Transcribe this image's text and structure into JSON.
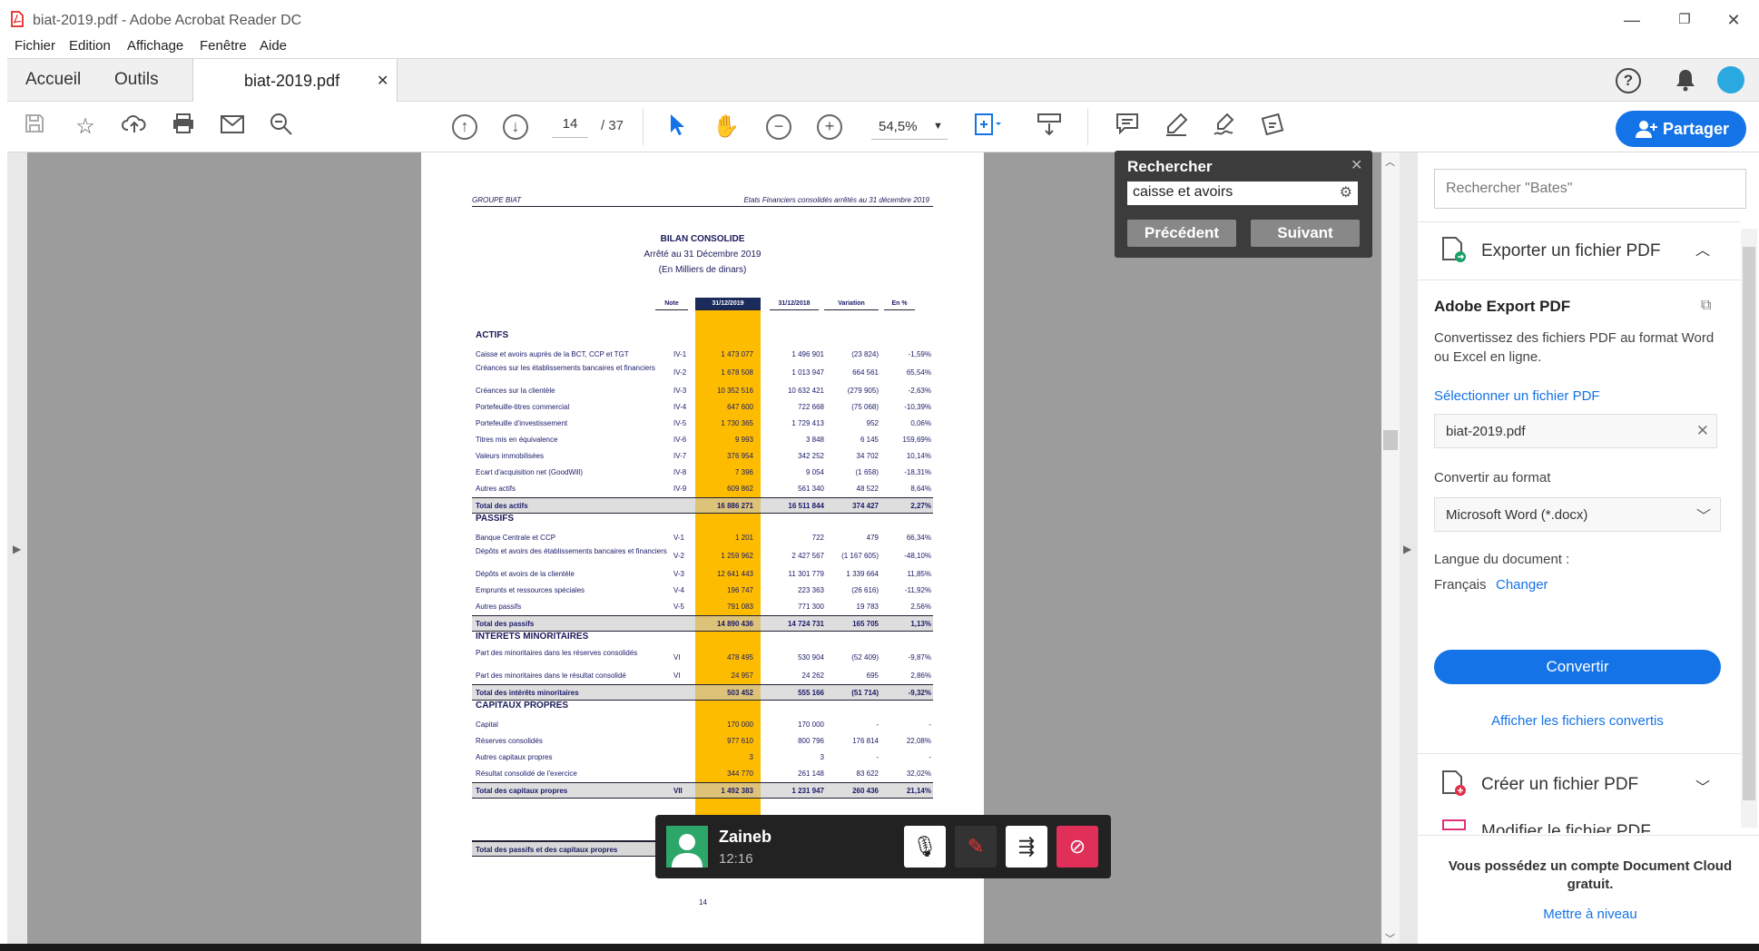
{
  "window": {
    "title": "biat-2019.pdf - Adobe Acrobat Reader DC"
  },
  "menu": [
    "Fichier",
    "Edition",
    "Affichage",
    "Fenêtre",
    "Aide"
  ],
  "tabs": {
    "home": "Accueil",
    "tools": "Outils",
    "doc": "biat-2019.pdf"
  },
  "toolbar": {
    "page_current": "14",
    "page_total": "/ 37",
    "zoom": "54,5%",
    "share": "Partager"
  },
  "find": {
    "title": "Rechercher",
    "value": "caisse et avoirs",
    "prev": "Précédent",
    "next": "Suivant"
  },
  "right": {
    "search_placeholder": "Rechercher \"Bates\"",
    "export_title": "Exporter un fichier PDF",
    "adobe_export": "Adobe Export PDF",
    "desc": "Convertissez des fichiers PDF au format Word ou Excel en ligne.",
    "select_file": "Sélectionner un fichier PDF",
    "file": "biat-2019.pdf",
    "convert_to": "Convertir au format",
    "format": "Microsoft Word (*.docx)",
    "lang_label": "Langue du document :",
    "lang": "Français",
    "change": "Changer",
    "convert_btn": "Convertir",
    "show_converted": "Afficher les fichiers convertis",
    "create": "Créer un fichier PDF",
    "modify": "Modifier le fichier PDF",
    "cloud": "Vous possédez un compte Document Cloud gratuit.",
    "upgrade": "Mettre à niveau"
  },
  "call": {
    "name": "Zaineb",
    "time": "12:16"
  },
  "pdf": {
    "header_left": "GROUPE BIAT",
    "header_right": "Etats Financiers consolidés arrêtés au 31 décembre 2019",
    "title": "BILAN CONSOLIDE",
    "sub1": "Arrêté au 31 Décembre 2019",
    "sub2": "(En Milliers de dinars)",
    "cols": [
      "Note",
      "31/12/2019",
      "31/12/2018",
      "Variation",
      "En %"
    ],
    "page_no": "14",
    "sections": [
      {
        "title": "ACTIFS",
        "rows": [
          [
            "Caisse et avoirs auprès de la BCT, CCP et TGT",
            "IV-1",
            "1 473 077",
            "1 496 901",
            "(23 824)",
            "-1,59%"
          ],
          [
            "Créances sur les établissements bancaires et financiers",
            "IV-2",
            "1 678 508",
            "1 013 947",
            "664 561",
            "65,54%"
          ],
          [
            "Créances sur la clientèle",
            "IV-3",
            "10 352 516",
            "10 632 421",
            "(279 905)",
            "-2,63%"
          ],
          [
            "Portefeuille-titres commercial",
            "IV-4",
            "647 600",
            "722 668",
            "(75 068)",
            "-10,39%"
          ],
          [
            "Portefeuille d'investissement",
            "IV-5",
            "1 730 365",
            "1 729 413",
            "952",
            "0,06%"
          ],
          [
            "Titres mis en équivalence",
            "IV-6",
            "9 993",
            "3 848",
            "6 145",
            "159,69%"
          ],
          [
            "Valeurs immobilisées",
            "IV-7",
            "376 954",
            "342 252",
            "34 702",
            "10,14%"
          ],
          [
            "Ecart d'acquisition net (GoodWill)",
            "IV-8",
            "7 396",
            "9 054",
            "(1 658)",
            "-18,31%"
          ],
          [
            "Autres actifs",
            "IV-9",
            "609 862",
            "561 340",
            "48 522",
            "8,64%"
          ]
        ],
        "total": [
          "Total des actifs",
          "",
          "16 886 271",
          "16 511 844",
          "374 427",
          "2,27%"
        ]
      },
      {
        "title": "PASSIFS",
        "rows": [
          [
            "Banque Centrale et CCP",
            "V-1",
            "1 201",
            "722",
            "479",
            "66,34%"
          ],
          [
            "Dépôts et avoirs des établissements bancaires et financiers",
            "V-2",
            "1 259 962",
            "2 427 567",
            "(1 167 605)",
            "-48,10%"
          ],
          [
            "Dépôts et avoirs de la clientèle",
            "V-3",
            "12 641 443",
            "11 301 779",
            "1 339 664",
            "11,85%"
          ],
          [
            "Emprunts et ressources spéciales",
            "V-4",
            "196 747",
            "223 363",
            "(26 616)",
            "-11,92%"
          ],
          [
            "Autres passifs",
            "V-5",
            "791 083",
            "771 300",
            "19 783",
            "2,56%"
          ]
        ],
        "total": [
          "Total des passifs",
          "",
          "14 890 436",
          "14 724 731",
          "165 705",
          "1,13%"
        ]
      },
      {
        "title": "INTERETS MINORITAIRES",
        "rows": [
          [
            "Part des minoritaires dans les réserves consolidés",
            "VI",
            "478 495",
            "530 904",
            "(52 409)",
            "-9,87%"
          ],
          [
            "Part des minoritaires dans le résultat consolidé",
            "VI",
            "24 957",
            "24 262",
            "695",
            "2,86%"
          ]
        ],
        "total": [
          "Total des intérêts minoritaires",
          "",
          "503 452",
          "555 166",
          "(51 714)",
          "-9,32%"
        ]
      },
      {
        "title": "CAPITAUX PROPRES",
        "rows": [
          [
            "Capital",
            "",
            "170 000",
            "170 000",
            "-",
            "-"
          ],
          [
            "Réserves consolidés",
            "",
            "977 610",
            "800 796",
            "176 814",
            "22,08%"
          ],
          [
            "Autres capitaux propres",
            "",
            "3",
            "3",
            "-",
            "-"
          ],
          [
            "Résultat consolidé de l'exercice",
            "",
            "344 770",
            "261 148",
            "83 622",
            "32,02%"
          ]
        ],
        "total": [
          "Total des capitaux propres",
          "VII",
          "1 492 383",
          "1 231 947",
          "260 436",
          "21,14%"
        ]
      }
    ],
    "grand_total": "Total des passifs et des capitaux propres"
  }
}
